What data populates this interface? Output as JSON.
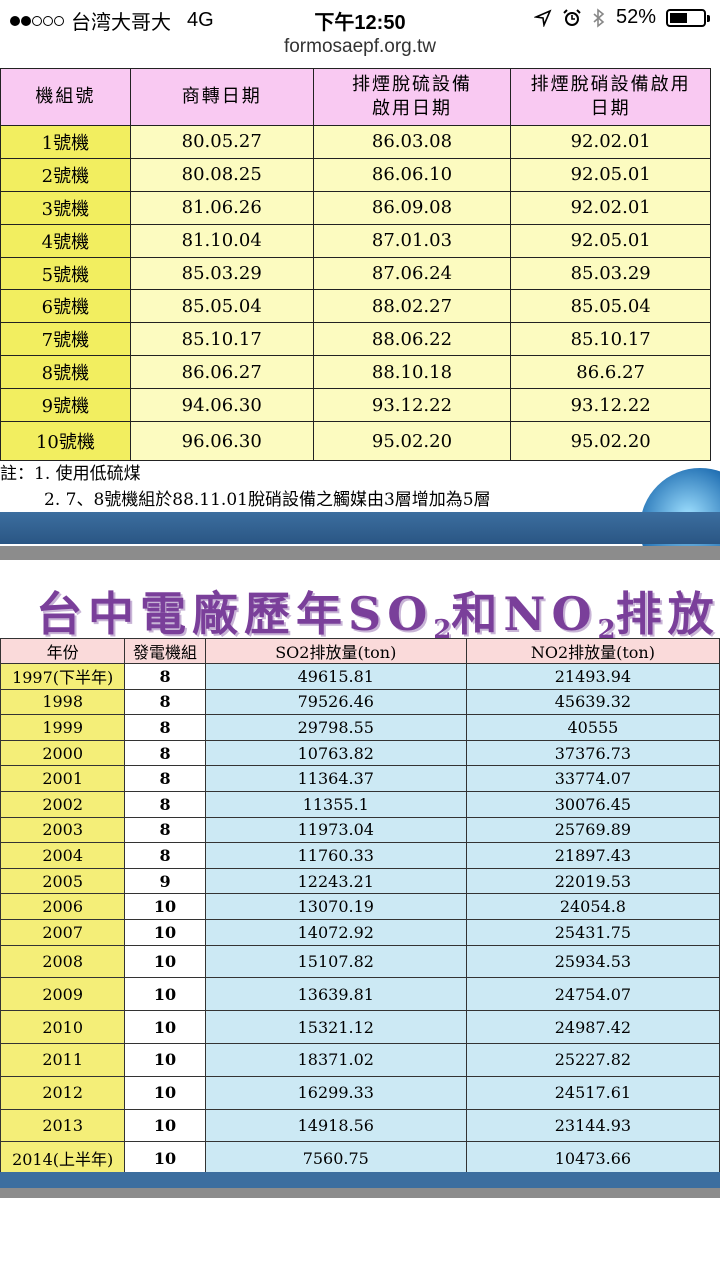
{
  "status_bar": {
    "carrier": "台湾大哥大",
    "network": "4G",
    "time": "下午12:50",
    "battery": "52%",
    "battery_fraction": 0.52,
    "signal_filled": 2,
    "signal_total": 5
  },
  "browser": {
    "url": "formosaepf.org.tw"
  },
  "unit_table": {
    "headers": [
      "機組號",
      "商轉日期",
      "排煙脫硫設備啟用日期",
      "排煙脫硝設備啟用日期"
    ],
    "header_lines": [
      [
        "機組號"
      ],
      [
        "商轉日期"
      ],
      [
        "排煙脫硫設備",
        "啟用日期"
      ],
      [
        "排煙脫硝設備啟用",
        "日期"
      ]
    ],
    "rows": [
      [
        "1號機",
        "80.05.27",
        "86.03.08",
        "92.02.01"
      ],
      [
        "2號機",
        "80.08.25",
        "86.06.10",
        "92.05.01"
      ],
      [
        "3號機",
        "81.06.26",
        "86.09.08",
        "92.02.01"
      ],
      [
        "4號機",
        "81.10.04",
        "87.01.03",
        "92.05.01"
      ],
      [
        "5號機",
        "85.03.29",
        "87.06.24",
        "85.03.29"
      ],
      [
        "6號機",
        "85.05.04",
        "88.02.27",
        "85.05.04"
      ],
      [
        "7號機",
        "85.10.17",
        "88.06.22",
        "85.10.17"
      ],
      [
        "8號機",
        "86.06.27",
        "88.10.18",
        "86.6.27"
      ],
      [
        "9號機",
        "94.06.30",
        "93.12.22",
        "93.12.22"
      ],
      [
        "10號機",
        "96.06.30",
        "95.02.20",
        "95.02.20"
      ]
    ],
    "notes_prefix": "註：",
    "notes": [
      "1. 使用低硫煤",
      "2. 7、8號機組於88.11.01脫硝設備之觸媒由3層增加為5層"
    ]
  },
  "emission_slide": {
    "title_parts": [
      "台中電廠歷年SO",
      "2",
      "和NO",
      "2",
      "排放量"
    ],
    "headers": [
      "年份",
      "發電機組",
      "SO2排放量(ton)",
      "NO2排放量(ton)"
    ],
    "rows": [
      [
        "1997(下半年)",
        "8",
        "49615.81",
        "21493.94"
      ],
      [
        "1998",
        "8",
        "79526.46",
        "45639.32"
      ],
      [
        "1999",
        "8",
        "29798.55",
        "40555"
      ],
      [
        "2000",
        "8",
        "10763.82",
        "37376.73"
      ],
      [
        "2001",
        "8",
        "11364.37",
        "33774.07"
      ],
      [
        "2002",
        "8",
        "11355.1",
        "30076.45"
      ],
      [
        "2003",
        "8",
        "11973.04",
        "25769.89"
      ],
      [
        "2004",
        "8",
        "11760.33",
        "21897.43"
      ],
      [
        "2005",
        "9",
        "12243.21",
        "22019.53"
      ],
      [
        "2006",
        "10",
        "13070.19",
        "24054.8"
      ],
      [
        "2007",
        "10",
        "14072.92",
        "25431.75"
      ],
      [
        "2008",
        "10",
        "15107.82",
        "25934.53"
      ],
      [
        "2009",
        "10",
        "13639.81",
        "24754.07"
      ],
      [
        "2010",
        "10",
        "15321.12",
        "24987.42"
      ],
      [
        "2011",
        "10",
        "18371.02",
        "25227.82"
      ],
      [
        "2012",
        "10",
        "16299.33",
        "24517.61"
      ],
      [
        "2013",
        "10",
        "14918.56",
        "23144.93"
      ],
      [
        "2014(上半年)",
        "10",
        "7560.75",
        "10473.66"
      ]
    ]
  },
  "colors": {
    "header_pink": "#f9c9f2",
    "unit_yellow": "#f2ee60",
    "cell_light_yellow": "#fcfbc0",
    "cell_light_blue": "#cce9f4",
    "title_purple": "#7a3f9a",
    "band_blue": "#3c6e9f"
  },
  "icons": [
    "location-arrow-icon",
    "alarm-clock-icon",
    "bluetooth-icon",
    "battery-icon",
    "globe-logo-icon"
  ]
}
